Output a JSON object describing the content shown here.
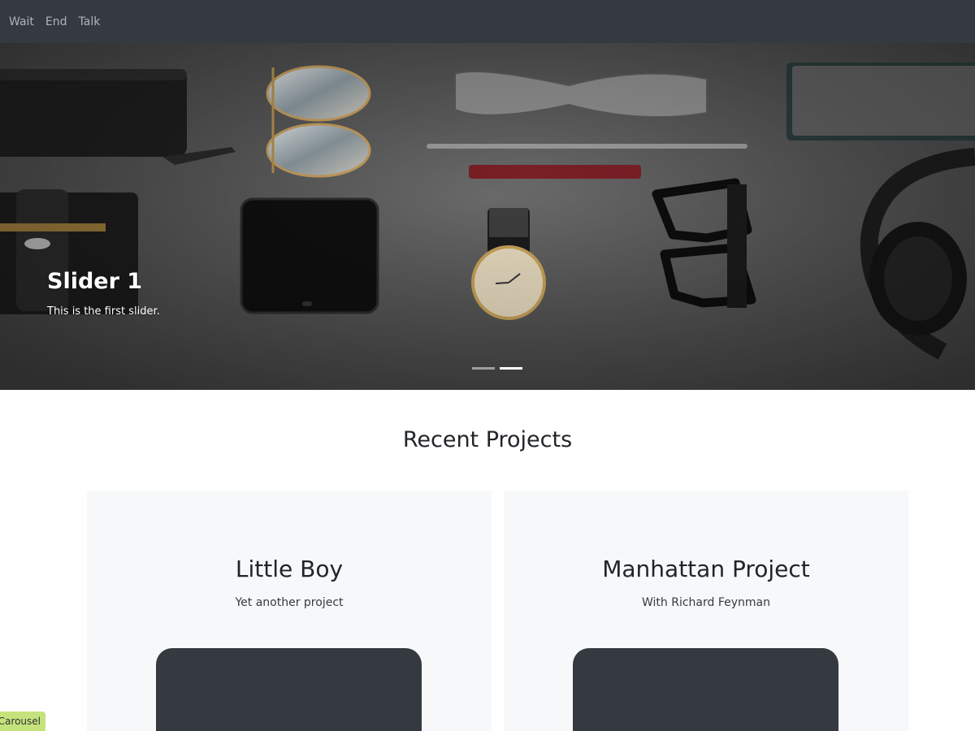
{
  "nav": {
    "links": [
      "Wait",
      "End",
      "Talk"
    ]
  },
  "carousel": {
    "title": "Slider 1",
    "description": "This is the first slider.",
    "indicator_count": 2,
    "active_index": 1
  },
  "projects": {
    "heading": "Recent Projects",
    "cards": [
      {
        "title": "Little Boy",
        "subtitle": "Yet another project"
      },
      {
        "title": "Manhattan Project",
        "subtitle": "With Richard Feynman"
      }
    ]
  },
  "badge": {
    "label": "Carousel"
  },
  "colors": {
    "nav_bg": "#343a40",
    "card_bg": "#f7f8fa",
    "card_box": "#343a40",
    "badge_bg": "#c5e37d"
  }
}
